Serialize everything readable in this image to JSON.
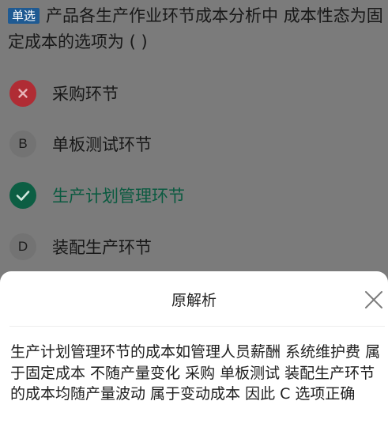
{
  "question": {
    "type_badge": "单选",
    "text": "产品各生产作业环节成本分析中 成本性态为固定成本的选项为 ( )"
  },
  "options": [
    {
      "marker": "",
      "text": "采购环节",
      "state": "wrong",
      "icon": "close-icon"
    },
    {
      "marker": "B",
      "text": "单板测试环节",
      "state": "normal"
    },
    {
      "marker": "",
      "text": "生产计划管理环节",
      "state": "correct",
      "icon": "check-icon"
    },
    {
      "marker": "D",
      "text": "装配生产环节",
      "state": "normal"
    }
  ],
  "analysis_sheet": {
    "title": "原解析",
    "close_icon": "close-icon",
    "body": "生产计划管理环节的成本如管理人员薪酬 系统维护费 属于固定成本 不随产量变化 采购 单板测试 装配生产环节的成本均随产量波动 属于变动成本 因此 C 选项正确"
  },
  "colors": {
    "overlay": "#7b7b7b",
    "badge": "#1f5a92",
    "wrong": "#b02c34",
    "correct": "#0c5e43",
    "sheet": "#ffffff"
  }
}
